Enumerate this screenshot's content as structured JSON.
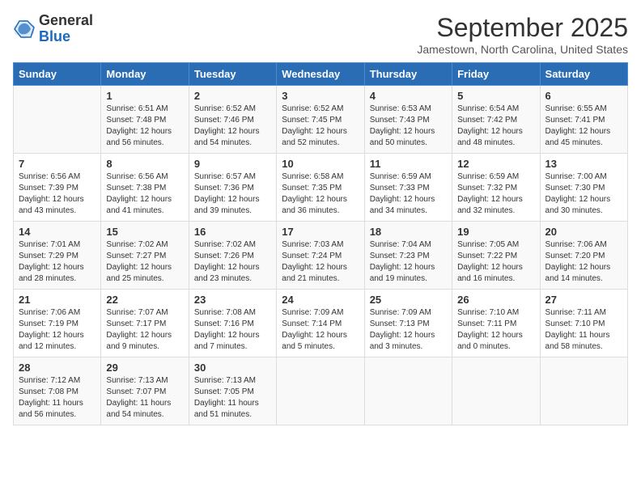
{
  "logo": {
    "general": "General",
    "blue": "Blue"
  },
  "header": {
    "month_title": "September 2025",
    "location": "Jamestown, North Carolina, United States"
  },
  "weekdays": [
    "Sunday",
    "Monday",
    "Tuesday",
    "Wednesday",
    "Thursday",
    "Friday",
    "Saturday"
  ],
  "weeks": [
    [
      {
        "day": "",
        "sunrise": "",
        "sunset": "",
        "daylight": ""
      },
      {
        "day": "1",
        "sunrise": "Sunrise: 6:51 AM",
        "sunset": "Sunset: 7:48 PM",
        "daylight": "Daylight: 12 hours and 56 minutes."
      },
      {
        "day": "2",
        "sunrise": "Sunrise: 6:52 AM",
        "sunset": "Sunset: 7:46 PM",
        "daylight": "Daylight: 12 hours and 54 minutes."
      },
      {
        "day": "3",
        "sunrise": "Sunrise: 6:52 AM",
        "sunset": "Sunset: 7:45 PM",
        "daylight": "Daylight: 12 hours and 52 minutes."
      },
      {
        "day": "4",
        "sunrise": "Sunrise: 6:53 AM",
        "sunset": "Sunset: 7:43 PM",
        "daylight": "Daylight: 12 hours and 50 minutes."
      },
      {
        "day": "5",
        "sunrise": "Sunrise: 6:54 AM",
        "sunset": "Sunset: 7:42 PM",
        "daylight": "Daylight: 12 hours and 48 minutes."
      },
      {
        "day": "6",
        "sunrise": "Sunrise: 6:55 AM",
        "sunset": "Sunset: 7:41 PM",
        "daylight": "Daylight: 12 hours and 45 minutes."
      }
    ],
    [
      {
        "day": "7",
        "sunrise": "Sunrise: 6:56 AM",
        "sunset": "Sunset: 7:39 PM",
        "daylight": "Daylight: 12 hours and 43 minutes."
      },
      {
        "day": "8",
        "sunrise": "Sunrise: 6:56 AM",
        "sunset": "Sunset: 7:38 PM",
        "daylight": "Daylight: 12 hours and 41 minutes."
      },
      {
        "day": "9",
        "sunrise": "Sunrise: 6:57 AM",
        "sunset": "Sunset: 7:36 PM",
        "daylight": "Daylight: 12 hours and 39 minutes."
      },
      {
        "day": "10",
        "sunrise": "Sunrise: 6:58 AM",
        "sunset": "Sunset: 7:35 PM",
        "daylight": "Daylight: 12 hours and 36 minutes."
      },
      {
        "day": "11",
        "sunrise": "Sunrise: 6:59 AM",
        "sunset": "Sunset: 7:33 PM",
        "daylight": "Daylight: 12 hours and 34 minutes."
      },
      {
        "day": "12",
        "sunrise": "Sunrise: 6:59 AM",
        "sunset": "Sunset: 7:32 PM",
        "daylight": "Daylight: 12 hours and 32 minutes."
      },
      {
        "day": "13",
        "sunrise": "Sunrise: 7:00 AM",
        "sunset": "Sunset: 7:30 PM",
        "daylight": "Daylight: 12 hours and 30 minutes."
      }
    ],
    [
      {
        "day": "14",
        "sunrise": "Sunrise: 7:01 AM",
        "sunset": "Sunset: 7:29 PM",
        "daylight": "Daylight: 12 hours and 28 minutes."
      },
      {
        "day": "15",
        "sunrise": "Sunrise: 7:02 AM",
        "sunset": "Sunset: 7:27 PM",
        "daylight": "Daylight: 12 hours and 25 minutes."
      },
      {
        "day": "16",
        "sunrise": "Sunrise: 7:02 AM",
        "sunset": "Sunset: 7:26 PM",
        "daylight": "Daylight: 12 hours and 23 minutes."
      },
      {
        "day": "17",
        "sunrise": "Sunrise: 7:03 AM",
        "sunset": "Sunset: 7:24 PM",
        "daylight": "Daylight: 12 hours and 21 minutes."
      },
      {
        "day": "18",
        "sunrise": "Sunrise: 7:04 AM",
        "sunset": "Sunset: 7:23 PM",
        "daylight": "Daylight: 12 hours and 19 minutes."
      },
      {
        "day": "19",
        "sunrise": "Sunrise: 7:05 AM",
        "sunset": "Sunset: 7:22 PM",
        "daylight": "Daylight: 12 hours and 16 minutes."
      },
      {
        "day": "20",
        "sunrise": "Sunrise: 7:06 AM",
        "sunset": "Sunset: 7:20 PM",
        "daylight": "Daylight: 12 hours and 14 minutes."
      }
    ],
    [
      {
        "day": "21",
        "sunrise": "Sunrise: 7:06 AM",
        "sunset": "Sunset: 7:19 PM",
        "daylight": "Daylight: 12 hours and 12 minutes."
      },
      {
        "day": "22",
        "sunrise": "Sunrise: 7:07 AM",
        "sunset": "Sunset: 7:17 PM",
        "daylight": "Daylight: 12 hours and 9 minutes."
      },
      {
        "day": "23",
        "sunrise": "Sunrise: 7:08 AM",
        "sunset": "Sunset: 7:16 PM",
        "daylight": "Daylight: 12 hours and 7 minutes."
      },
      {
        "day": "24",
        "sunrise": "Sunrise: 7:09 AM",
        "sunset": "Sunset: 7:14 PM",
        "daylight": "Daylight: 12 hours and 5 minutes."
      },
      {
        "day": "25",
        "sunrise": "Sunrise: 7:09 AM",
        "sunset": "Sunset: 7:13 PM",
        "daylight": "Daylight: 12 hours and 3 minutes."
      },
      {
        "day": "26",
        "sunrise": "Sunrise: 7:10 AM",
        "sunset": "Sunset: 7:11 PM",
        "daylight": "Daylight: 12 hours and 0 minutes."
      },
      {
        "day": "27",
        "sunrise": "Sunrise: 7:11 AM",
        "sunset": "Sunset: 7:10 PM",
        "daylight": "Daylight: 11 hours and 58 minutes."
      }
    ],
    [
      {
        "day": "28",
        "sunrise": "Sunrise: 7:12 AM",
        "sunset": "Sunset: 7:08 PM",
        "daylight": "Daylight: 11 hours and 56 minutes."
      },
      {
        "day": "29",
        "sunrise": "Sunrise: 7:13 AM",
        "sunset": "Sunset: 7:07 PM",
        "daylight": "Daylight: 11 hours and 54 minutes."
      },
      {
        "day": "30",
        "sunrise": "Sunrise: 7:13 AM",
        "sunset": "Sunset: 7:05 PM",
        "daylight": "Daylight: 11 hours and 51 minutes."
      },
      {
        "day": "",
        "sunrise": "",
        "sunset": "",
        "daylight": ""
      },
      {
        "day": "",
        "sunrise": "",
        "sunset": "",
        "daylight": ""
      },
      {
        "day": "",
        "sunrise": "",
        "sunset": "",
        "daylight": ""
      },
      {
        "day": "",
        "sunrise": "",
        "sunset": "",
        "daylight": ""
      }
    ]
  ]
}
